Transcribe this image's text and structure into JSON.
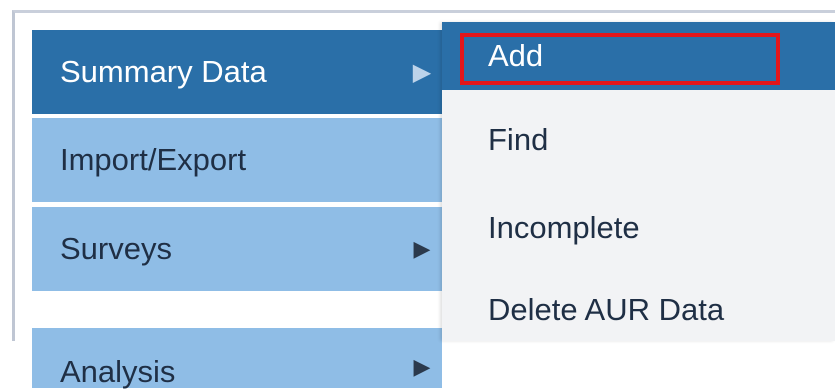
{
  "main_menu": {
    "items": [
      {
        "label": "Summary Data",
        "has_submenu": true,
        "state": "active"
      },
      {
        "label": "Import/Export",
        "has_submenu": false,
        "state": "normal"
      },
      {
        "label": "Surveys",
        "has_submenu": true,
        "state": "normal"
      },
      {
        "label": "Analysis",
        "has_submenu": true,
        "state": "normal"
      }
    ],
    "arrow_glyph": "▶"
  },
  "submenu": {
    "items": [
      {
        "label": "Add",
        "state": "hover"
      },
      {
        "label": "Find",
        "state": "normal"
      },
      {
        "label": "Incomplete",
        "state": "normal"
      },
      {
        "label": "Delete AUR Data",
        "state": "normal"
      }
    ]
  },
  "colors": {
    "active": "#2a6fa8",
    "menu_item": "#8fbde6",
    "submenu_bg": "#f2f3f5",
    "highlight": "#e3161b"
  }
}
